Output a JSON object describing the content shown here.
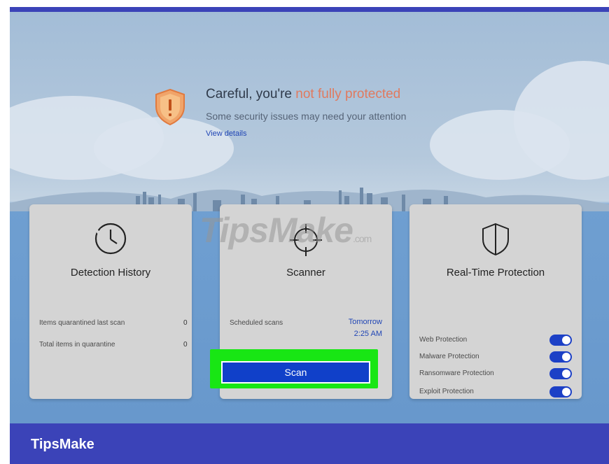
{
  "hero": {
    "title_prefix": "Careful, you're",
    "title_warning": "not fully protected",
    "subtitle": "Some security issues may need your attention",
    "link": "View details"
  },
  "cards": {
    "detection": {
      "title": "Detection History",
      "rows": [
        {
          "label": "Items quarantined last scan",
          "value": "0"
        },
        {
          "label": "Total items in quarantine",
          "value": "0"
        }
      ]
    },
    "scanner": {
      "title": "Scanner",
      "scheduled_label": "Scheduled scans",
      "scheduled_day": "Tomorrow",
      "scheduled_time": "2:25 AM",
      "scan_button": "Scan"
    },
    "realtime": {
      "title": "Real-Time Protection",
      "items": [
        {
          "label": "Web Protection",
          "on": true
        },
        {
          "label": "Malware Protection",
          "on": true
        },
        {
          "label": "Ransomware Protection",
          "on": true
        },
        {
          "label": "Exploit Protection",
          "on": true
        }
      ]
    }
  },
  "watermark": {
    "text": "TipsMake",
    "suffix": ".com"
  },
  "footer": {
    "brand": "TipsMake"
  },
  "colors": {
    "accent": "#1c40c6",
    "warning": "#e07a5f",
    "highlight": "#18e614",
    "banner": "#3b43b8"
  }
}
